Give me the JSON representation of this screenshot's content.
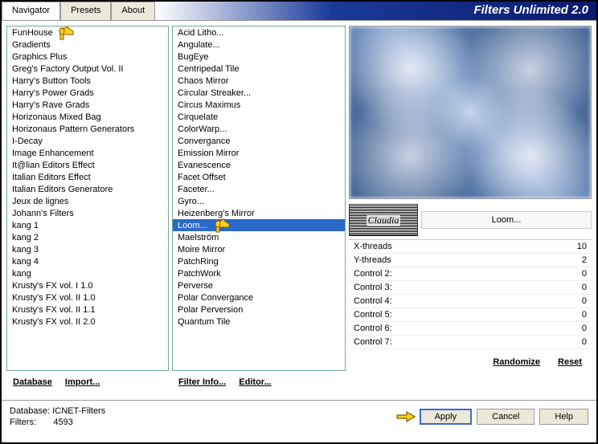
{
  "title": "Filters Unlimited 2.0",
  "tabs": [
    "Navigator",
    "Presets",
    "About"
  ],
  "active_tab": 0,
  "categories": [
    "FunHouse",
    "Gradients",
    "Graphics Plus",
    "Greg's Factory Output Vol. II",
    "Harry's Button Tools",
    "Harry's Power Grads",
    "Harry's Rave Grads",
    "Horizonaus Mixed Bag",
    "Horizonaus Pattern Generators",
    "I-Decay",
    "Image Enhancement",
    "It@lian Editors Effect",
    "Italian Editors Effect",
    "Italian Editors Generatore",
    "Jeux de lignes",
    "Johann's Filters",
    "kang 1",
    "kang 2",
    "kang 3",
    "kang 4",
    "kang",
    "Krusty's FX vol. I 1.0",
    "Krusty's FX vol. II 1.0",
    "Krusty's FX vol. II 1.1",
    "Krusty's FX vol. II 2.0"
  ],
  "pointer_cat_index": 0,
  "filters": [
    "Acid Litho...",
    "Angulate...",
    "BugEye",
    "Centripedal Tile",
    "Chaos Mirror",
    "Circular Streaker...",
    "Circus Maximus",
    "Cirquelate",
    "ColorWarp...",
    "Convergance",
    "Emission Mirror",
    "Evanescence",
    "Facet Offset",
    "Faceter...",
    "Gyro...",
    "Heizenberg's Mirror",
    "Loom...",
    "Maelström",
    "Moire Mirror",
    "PatchRing",
    "PatchWork",
    "Perverse",
    "Polar Convergance",
    "Polar Perversion",
    "Quantum Tile"
  ],
  "selected_filter_index": 16,
  "pointer_filter_index": 16,
  "buttons_row1": {
    "database": "Database",
    "import": "Import..."
  },
  "buttons_row2": {
    "filterinfo": "Filter Info...",
    "editor": "Editor..."
  },
  "logo_text": "Claudia",
  "current_filter": "Loom...",
  "params": [
    {
      "label": "X-threads",
      "value": "10"
    },
    {
      "label": "Y-threads",
      "value": "2"
    },
    {
      "label": "Control 2:",
      "value": "0"
    },
    {
      "label": "Control 3:",
      "value": "0"
    },
    {
      "label": "Control 4:",
      "value": "0"
    },
    {
      "label": "Control 5:",
      "value": "0"
    },
    {
      "label": "Control 6:",
      "value": "0"
    },
    {
      "label": "Control 7:",
      "value": "0"
    }
  ],
  "buttons_row3": {
    "randomize": "Randomize",
    "reset": "Reset"
  },
  "status": {
    "db_label": "Database:",
    "db_value": "ICNET-Filters",
    "filters_label": "Filters:",
    "filters_value": "4593"
  },
  "actions": {
    "apply": "Apply",
    "cancel": "Cancel",
    "help": "Help"
  }
}
